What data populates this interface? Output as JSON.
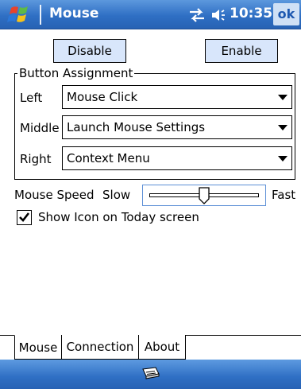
{
  "window": {
    "title": "Mouse",
    "clock": "10:35",
    "ok_label": "ok",
    "icons": [
      "windows-start-icon",
      "connectivity-icon",
      "volume-icon",
      "keyboard-icon"
    ]
  },
  "actions": {
    "disable_label": "Disable",
    "enable_label": "Enable"
  },
  "button_assignment": {
    "legend": "Button Assignment",
    "rows": [
      {
        "label": "Left",
        "value": "Mouse Click"
      },
      {
        "label": "Middle",
        "value": "Launch Mouse Settings"
      },
      {
        "label": "Right",
        "value": "Context Menu"
      }
    ]
  },
  "speed": {
    "label": "Mouse Speed",
    "slow_label": "Slow",
    "fast_label": "Fast",
    "level": 0.5
  },
  "show_icon": {
    "label": "Show Icon on Today screen",
    "checked": true
  },
  "tabs": [
    {
      "label": "Mouse",
      "active": true
    },
    {
      "label": "Connection",
      "active": false
    },
    {
      "label": "About",
      "active": false
    }
  ],
  "colors": {
    "titlebar": "#2f6fc4",
    "button_fill": "#d8e6fb",
    "slider_frame": "#5c8fd6"
  }
}
